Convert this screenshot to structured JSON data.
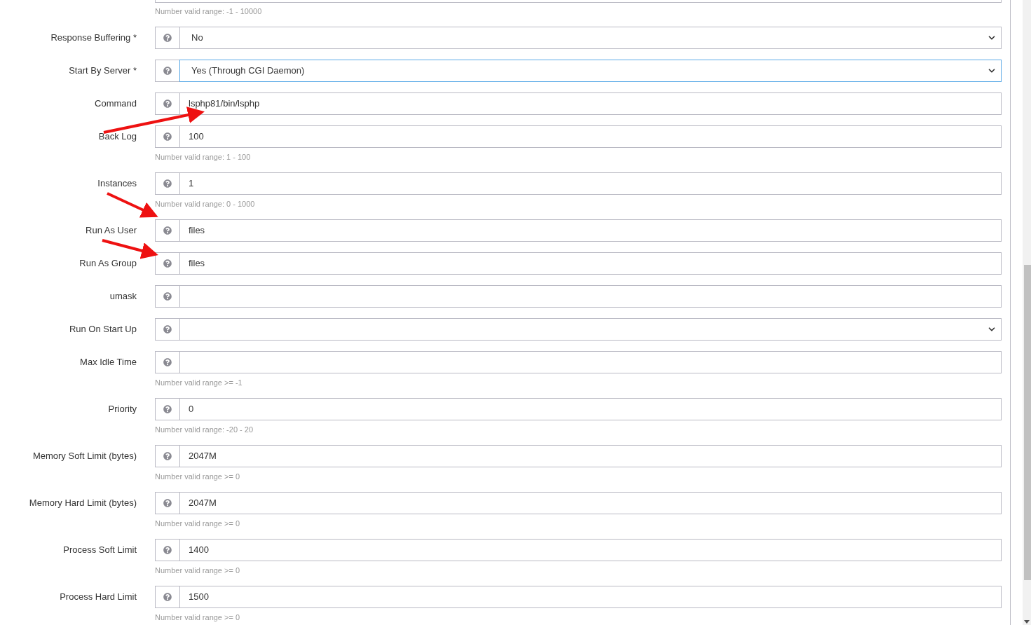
{
  "top_hint": "Number valid range: -1 - 10000",
  "rows": [
    {
      "label": "Response Buffering *",
      "kind": "select",
      "value": "No",
      "focused": false
    },
    {
      "label": "Start By Server *",
      "kind": "select",
      "value": "Yes (Through CGI Daemon)",
      "focused": true
    },
    {
      "label": "Command",
      "kind": "text",
      "value": "lsphp81/bin/lsphp",
      "focused": false
    },
    {
      "label": "Back Log",
      "kind": "text",
      "value": "100",
      "focused": false,
      "hint": "Number valid range: 1 - 100"
    },
    {
      "label": "Instances",
      "kind": "text",
      "value": "1",
      "focused": false,
      "hint": "Number valid range: 0 - 1000"
    },
    {
      "label": "Run As User",
      "kind": "text",
      "value": "files",
      "focused": false
    },
    {
      "label": "Run As Group",
      "kind": "text",
      "value": "files",
      "focused": false
    },
    {
      "label": "umask",
      "kind": "text",
      "focused": false
    },
    {
      "label": "Run On Start Up",
      "kind": "select",
      "focused": false
    },
    {
      "label": "Max Idle Time",
      "kind": "text",
      "focused": false,
      "hint": "Number valid range >= -1"
    },
    {
      "label": "Priority",
      "kind": "text",
      "value": "0",
      "focused": false,
      "hint": "Number valid range: -20 - 20"
    },
    {
      "label": "Memory Soft Limit (bytes)",
      "kind": "text",
      "value": "2047M",
      "focused": false,
      "hint": "Number valid range >= 0"
    },
    {
      "label": "Memory Hard Limit (bytes)",
      "kind": "text",
      "value": "2047M",
      "focused": false,
      "hint": "Number valid range >= 0"
    },
    {
      "label": "Process Soft Limit",
      "kind": "text",
      "value": "1400",
      "focused": false,
      "hint": "Number valid range >= 0"
    },
    {
      "label": "Process Hard Limit",
      "kind": "text",
      "value": "1500",
      "focused": false,
      "hint": "Number valid range >= 0"
    }
  ]
}
